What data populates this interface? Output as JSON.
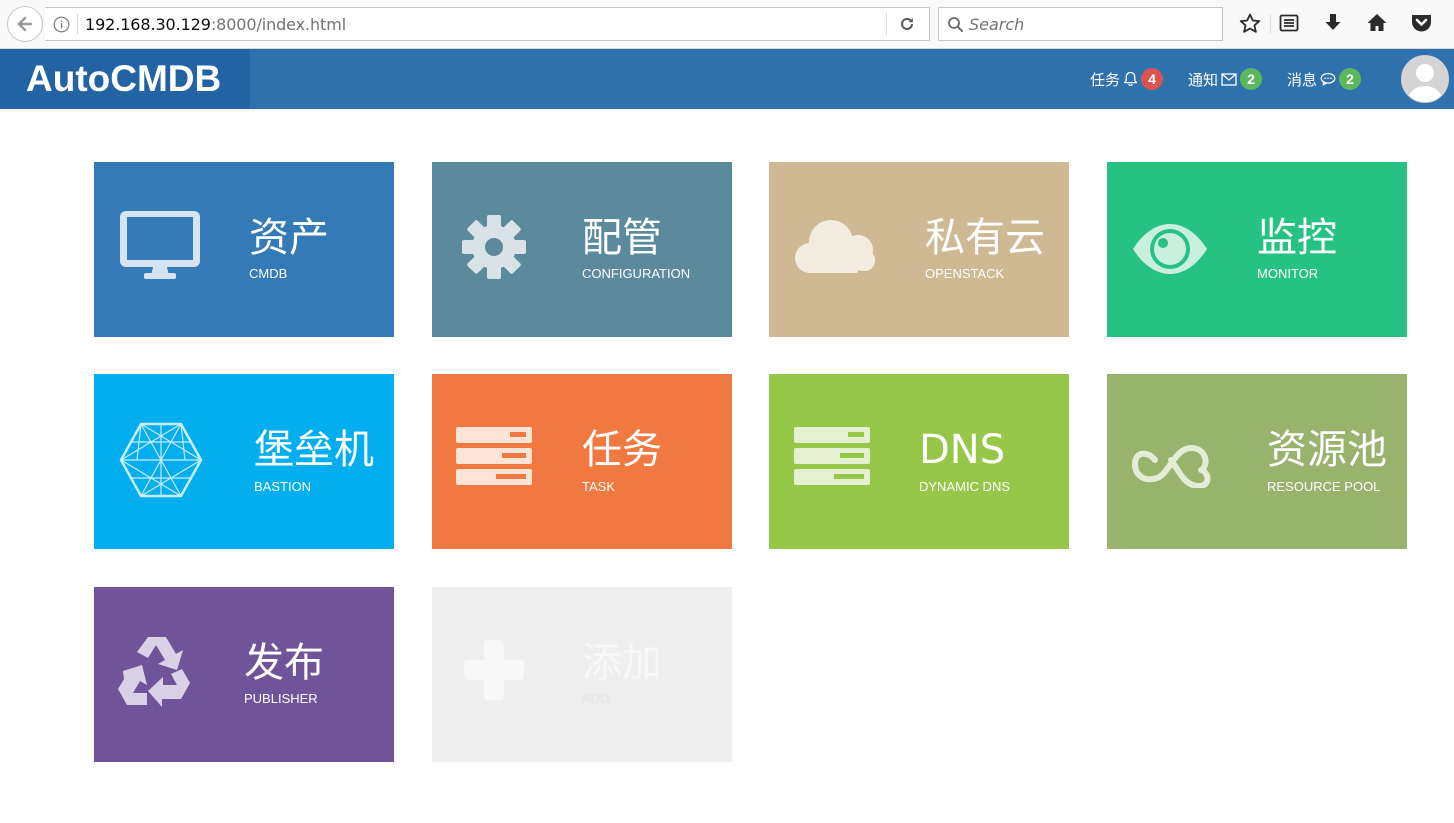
{
  "browser": {
    "url_host": "192.168.30.129",
    "url_rest": ":8000/index.html",
    "search_placeholder": "Search"
  },
  "app": {
    "brand": "AutoCMDB",
    "nav": [
      {
        "label": "任务",
        "icon": "bell-icon",
        "count": "4",
        "badge_color": "#d9534f"
      },
      {
        "label": "通知",
        "icon": "envelope-icon",
        "count": "2",
        "badge_color": "#5cb85c"
      },
      {
        "label": "消息",
        "icon": "comment-icon",
        "count": "2",
        "badge_color": "#5cb85c"
      }
    ]
  },
  "tiles": [
    {
      "title": "资产",
      "subtitle": "CMDB",
      "icon": "monitor-icon",
      "color": "#337ab7"
    },
    {
      "title": "配管",
      "subtitle": "CONFIGURATION",
      "icon": "gear-icon",
      "color": "#5a8a9c"
    },
    {
      "title": "私有云",
      "subtitle": "OPENSTACK",
      "icon": "cloud-icon",
      "color": "#cfb995"
    },
    {
      "title": "监控",
      "subtitle": "MONITOR",
      "icon": "eye-icon",
      "color": "#26c281"
    },
    {
      "title": "堡垒机",
      "subtitle": "BASTION",
      "icon": "hexagon-network-icon",
      "color": "#03aeef"
    },
    {
      "title": "任务",
      "subtitle": "TASK",
      "icon": "server-stack-icon",
      "color": "#f07841"
    },
    {
      "title": "DNS",
      "subtitle": "DYNAMIC DNS",
      "icon": "server-stack-icon",
      "color": "#97c748"
    },
    {
      "title": "资源池",
      "subtitle": "RESOURCE POOL",
      "icon": "infinity-cloud-icon",
      "color": "#98b36c"
    },
    {
      "title": "发布",
      "subtitle": "PUBLISHER",
      "icon": "recycle-icon",
      "color": "#6f5499"
    },
    {
      "title": "添加",
      "subtitle": "ADD",
      "icon": "plus-icon",
      "color": "#eeeeee"
    }
  ]
}
